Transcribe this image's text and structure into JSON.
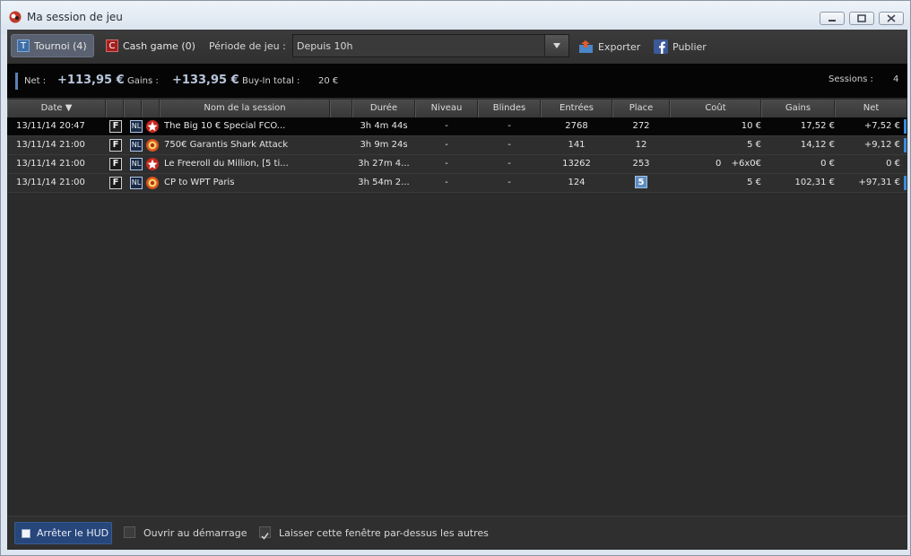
{
  "window": {
    "title": "Ma session de jeu"
  },
  "toolbar": {
    "tournoi": {
      "badge": "T",
      "label": "Tournoi (4)"
    },
    "cash": {
      "badge": "C",
      "label": "Cash game (0)"
    },
    "period_label": "Période de jeu :",
    "period_value": "Depuis 10h",
    "export_label": "Exporter",
    "publish_label": "Publier"
  },
  "summary": {
    "net_label": "Net :",
    "net_value": "+113,95 €",
    "gains_label": "Gains :",
    "gains_value": "+133,95 €",
    "buyin_label": "Buy-In total :",
    "buyin_value": "20 €",
    "sessions_label": "Sessions :",
    "sessions_value": "4"
  },
  "table": {
    "headers": {
      "date": "Date ▼",
      "name": "Nom de la session",
      "duree": "Durée",
      "niveau": "Niveau",
      "blindes": "Blindes",
      "entrees": "Entrées",
      "place": "Place",
      "cout": "Coût",
      "gains": "Gains",
      "net": "Net"
    },
    "rows": [
      {
        "date": "13/11/14 20:47",
        "f": "F",
        "nl": "NL",
        "room": "pokerstars",
        "name": "The Big 10 € Special FCO...",
        "duree": "3h 4m 44s",
        "niveau": "-",
        "blindes": "-",
        "entrees": "2768",
        "place": "272",
        "cout": "10 €",
        "gains": "17,52 €",
        "net": "+7,52 €"
      },
      {
        "date": "13/11/14 21:00",
        "f": "F",
        "nl": "NL",
        "room": "winamax",
        "name": "750€ Garantis Shark Attack",
        "duree": "3h 9m 24s",
        "niveau": "-",
        "blindes": "-",
        "entrees": "141",
        "place": "12",
        "cout": "5 €",
        "gains": "14,12 €",
        "net": "+9,12 €"
      },
      {
        "date": "13/11/14 21:00",
        "f": "F",
        "nl": "NL",
        "room": "pokerstars",
        "name": "Le Freeroll du Million, [5 ti...",
        "duree": "3h 27m 4...",
        "niveau": "-",
        "blindes": "-",
        "entrees": "13262",
        "place": "253",
        "cout_left": "0",
        "cout": "+6x0€",
        "gains": "0 €",
        "net": "0 €"
      },
      {
        "date": "13/11/14 21:00",
        "f": "F",
        "nl": "NL",
        "room": "winamax",
        "name": "CP to WPT Paris",
        "duree": "3h 54m 2...",
        "niveau": "-",
        "blindes": "-",
        "entrees": "124",
        "place": "5",
        "cout": "5 €",
        "gains": "102,31 €",
        "net": "+97,31 €"
      }
    ]
  },
  "footer": {
    "hud_label": "Arrêter le HUD",
    "open_start_label": "Ouvrir au démarrage",
    "on_top_label": "Laisser cette fenêtre par-dessus les autres"
  }
}
